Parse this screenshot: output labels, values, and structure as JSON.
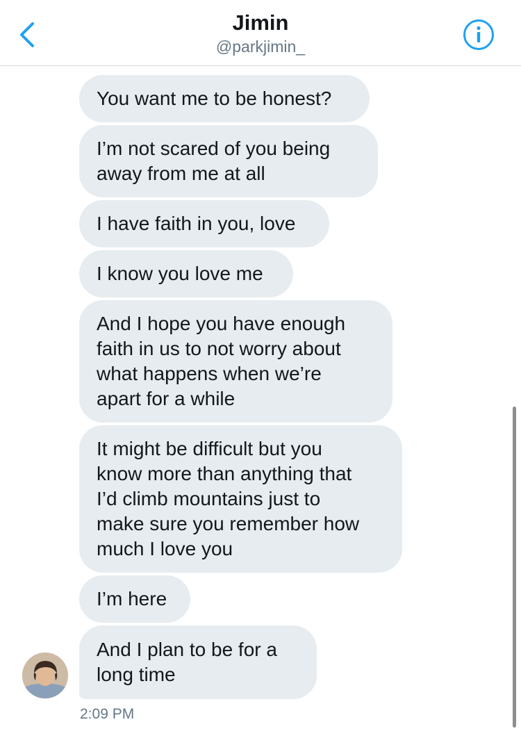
{
  "header": {
    "title": "Jimin",
    "handle": "@parkjimin_",
    "back_icon": "chevron-left-icon",
    "info_icon": "info-circle-icon",
    "accent_color": "#1da1f2"
  },
  "messages": [
    {
      "lines": [
        "You want me to be honest?"
      ]
    },
    {
      "lines": [
        "I’m not scared of you being",
        "away from me at all"
      ]
    },
    {
      "lines": [
        "I have faith in you, love"
      ]
    },
    {
      "lines": [
        "I know you love me"
      ]
    },
    {
      "lines": [
        "And I hope you have enough",
        "faith in us to not worry about",
        "what happens when we’re",
        "apart for a while"
      ]
    },
    {
      "lines": [
        "It might be difficult but you",
        "know more than anything that",
        "I’d climb mountains just to",
        "make sure you remember how",
        "much I love you"
      ]
    },
    {
      "lines": [
        "I’m here"
      ]
    },
    {
      "lines": [
        "And I plan to be for a",
        "long time"
      ]
    }
  ],
  "conversation": {
    "timestamp": "2:09 PM",
    "bubble_color": "#e6ecf0"
  }
}
